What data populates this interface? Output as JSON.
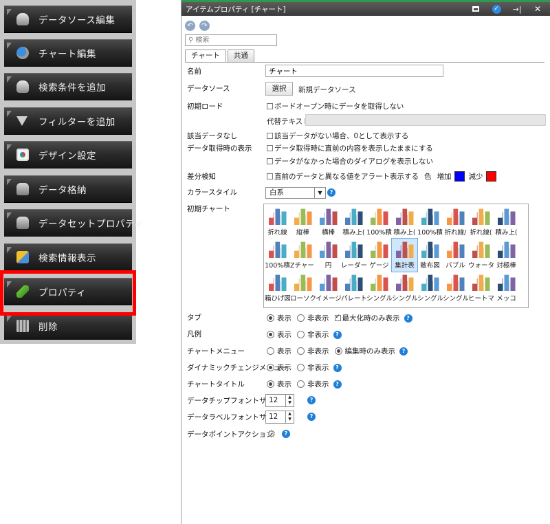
{
  "menu": {
    "items": [
      {
        "label": "データソース編集",
        "icon": "datasource-edit-icon"
      },
      {
        "label": "チャート編集",
        "icon": "chart-edit-icon"
      },
      {
        "label": "検索条件を追加",
        "icon": "search-condition-icon"
      },
      {
        "label": "フィルターを追加",
        "icon": "filter-icon"
      },
      {
        "label": "デザイン設定",
        "icon": "design-icon"
      },
      {
        "label": "データ格納",
        "icon": "data-store-icon"
      },
      {
        "label": "データセットプロパティ",
        "icon": "dataset-property-icon"
      },
      {
        "label": "検索情報表示",
        "icon": "search-info-icon"
      },
      {
        "label": "プロパティ",
        "icon": "pencil-icon"
      },
      {
        "label": "削除",
        "icon": "trash-icon"
      }
    ],
    "highlight_color": "#ff0000"
  },
  "dialog": {
    "title": "アイテムプロパティ [チャート]",
    "search_placeholder": "検索",
    "tabs": [
      "チャート",
      "共通"
    ],
    "labels": {
      "name": "名前",
      "datasource": "データソース",
      "initial_load": "初期ロード",
      "alt_text": "代替テキスト",
      "no_data": "該当データなし",
      "on_fetch": "データ取得時の表示",
      "diff_detect": "差分検知",
      "color_style": "カラースタイル",
      "initial_chart": "初期チャート",
      "tab": "タブ",
      "legend": "凡例",
      "chart_menu": "チャートメニュー",
      "dynamic_menu": "ダイナミックチェンジメニュー",
      "chart_title": "チャートタイトル",
      "chip_font": "データチップフォントサイズ",
      "label_font": "データラベルフォントサイズ",
      "point_action": "データポイントアクション"
    },
    "name_value": "チャート",
    "select_button": "選択",
    "datasource_value": "新規データソース",
    "initial_load_option": "ボードオープン時にデータを取得しない",
    "no_data_option": "該当データがない場合、0として表示する",
    "fetch_option1": "データ取得時に直前の内容を表示したままにする",
    "fetch_option2": "データがなかった場合のダイアログを表示しない",
    "diff_option": "直前のデータと異なる値をアラート表示する",
    "color_label": "色",
    "increase_label": "増加",
    "decrease_label": "減少",
    "increase_color": "#0000ff",
    "decrease_color": "#ff0000",
    "color_style_value": "白系",
    "charts": [
      {
        "label": "折れ線"
      },
      {
        "label": "縦棒"
      },
      {
        "label": "横棒"
      },
      {
        "label": "積み上("
      },
      {
        "label": "100%積"
      },
      {
        "label": "積み上("
      },
      {
        "label": "100%積"
      },
      {
        "label": "折れ線/"
      },
      {
        "label": "折れ線("
      },
      {
        "label": "積み上("
      },
      {
        "label": "100%積"
      },
      {
        "label": "Zチャート"
      },
      {
        "label": "円"
      },
      {
        "label": "レーダー"
      },
      {
        "label": "ゲージ"
      },
      {
        "label": "集計表",
        "selected": true
      },
      {
        "label": "散布図"
      },
      {
        "label": "バブル"
      },
      {
        "label": "ウォータ"
      },
      {
        "label": "対極棒"
      },
      {
        "label": "箱ひげ図"
      },
      {
        "label": "ローソク"
      },
      {
        "label": "イメージ"
      },
      {
        "label": "パレート"
      },
      {
        "label": "シングル"
      },
      {
        "label": "シングル"
      },
      {
        "label": "シングル"
      },
      {
        "label": "シングル"
      },
      {
        "label": "ヒートマ"
      },
      {
        "label": "メッコ"
      }
    ],
    "show": "表示",
    "hide": "非表示",
    "tab_max_option": "最大化時のみ表示",
    "edit_only_option": "編集時のみ表示",
    "chip_font_value": "12",
    "label_font_value": "12"
  }
}
